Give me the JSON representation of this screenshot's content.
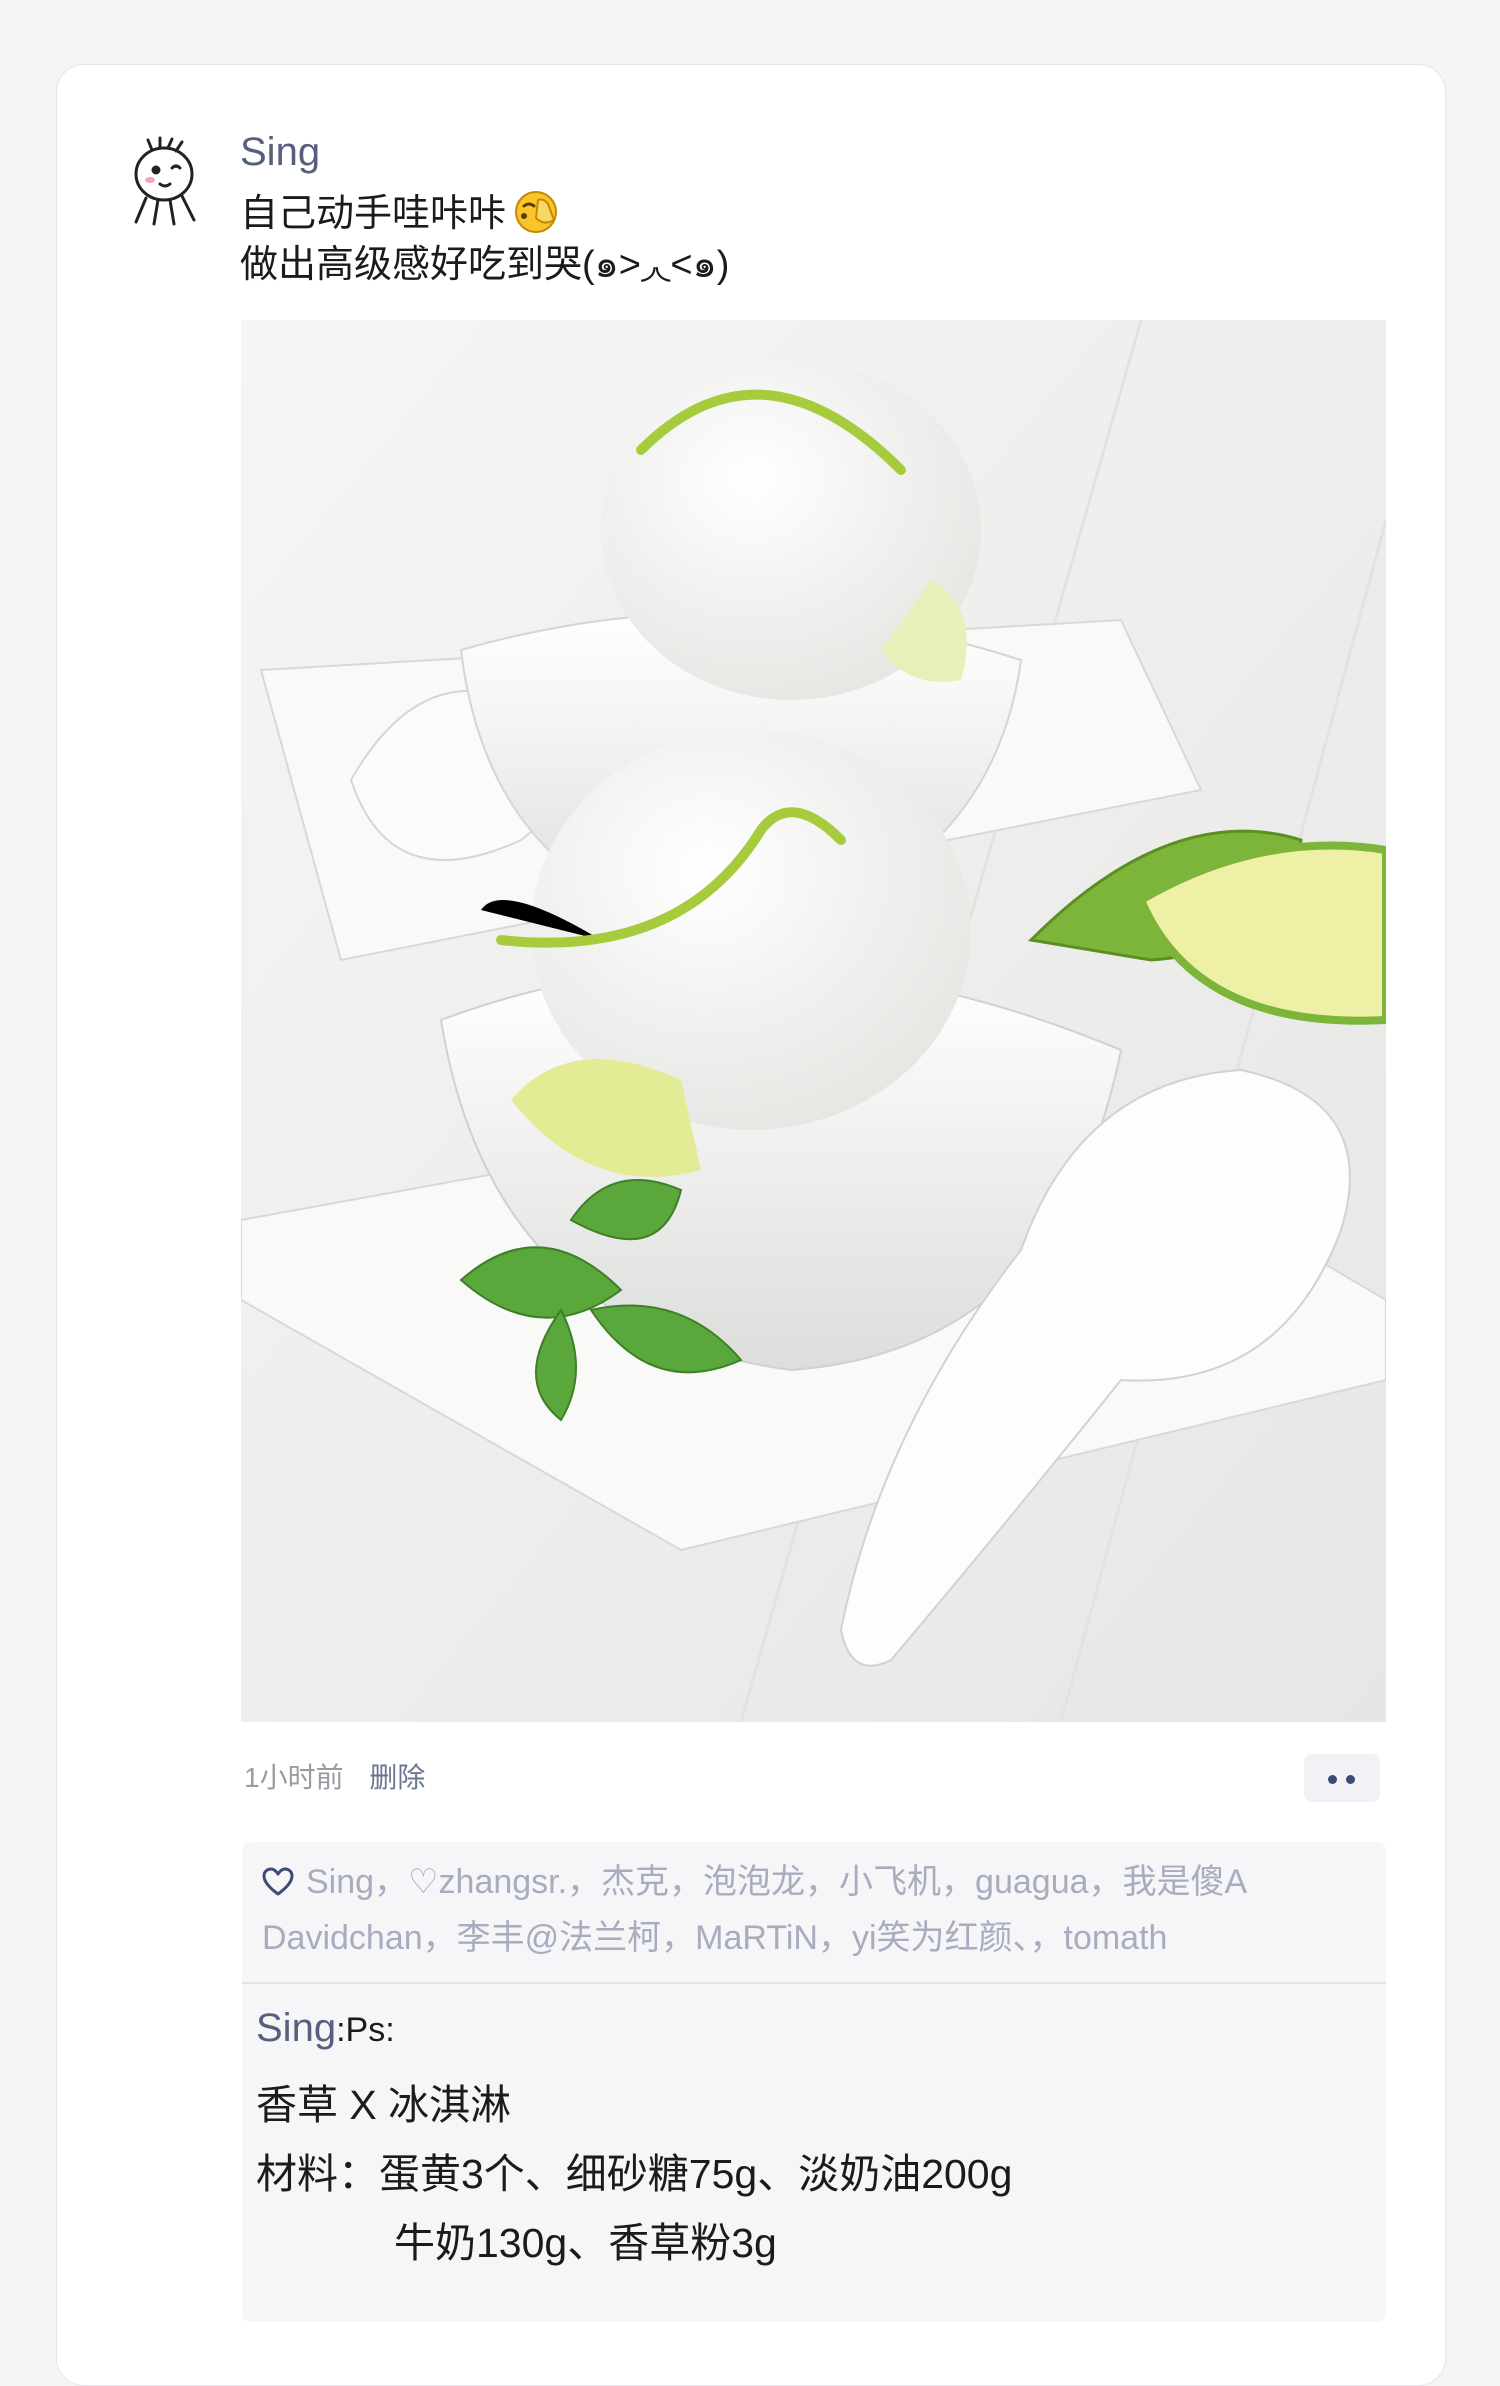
{
  "post": {
    "author": "Sing",
    "text_line1": "自己动手哇咔咔",
    "text_line2": "做出高级感好吃到哭(๑>◞◟<๑)",
    "time": "1小时前",
    "delete_label": "删除"
  },
  "likes": {
    "line1": "Sing，♡zhangsr.，杰克，泡泡龙，小飞机，guagua，我是傻A",
    "line2": "Davidchan，李丰@法兰柯，MaRTiN，yi笑为红颜、，tomath"
  },
  "comment": {
    "author": "Sing",
    "separator": ":",
    "prefix": "Ps:",
    "line1": "香草 X 冰淇淋",
    "line2": "材料：蛋黄3个、细砂糖75g、淡奶油200g",
    "line3": "牛奶130g、香草粉3g"
  },
  "colors": {
    "author_name": "#56607e",
    "likes_text": "#a7acbf",
    "lime": "#a6cc3d"
  }
}
